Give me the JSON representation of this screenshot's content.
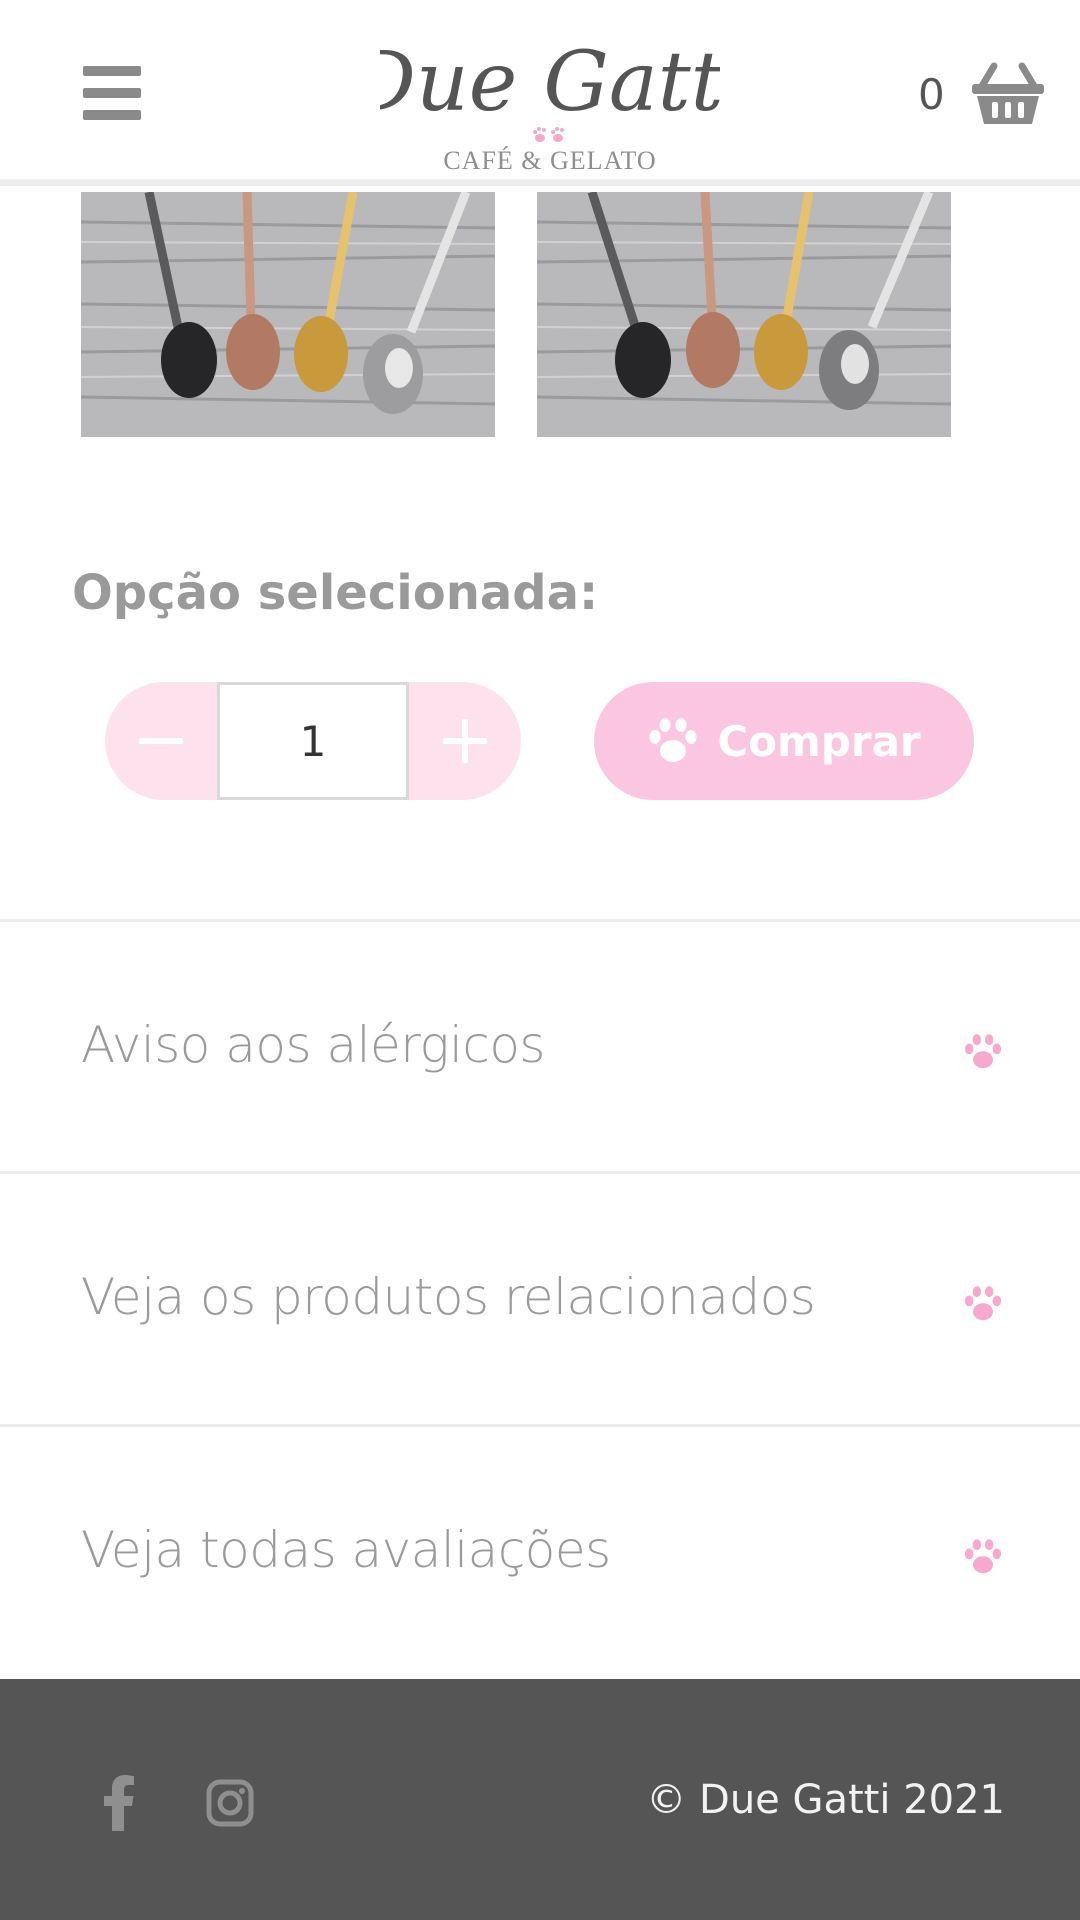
{
  "header": {
    "menu_icon": "hamburger-menu-icon",
    "logo_script": "Due Gatti",
    "logo_subtitle": "CAFÉ & GELATO",
    "cart_count": "0",
    "cart_icon": "basket-icon"
  },
  "product": {
    "images": [
      "spoons-photo",
      "spoons-photo"
    ],
    "option_label": "Opção selecionada:",
    "quantity": "1",
    "buy_label": "Comprar",
    "buy_icon": "paw-icon"
  },
  "accordion": [
    {
      "title": "Aviso aos alérgicos",
      "icon": "paw-icon"
    },
    {
      "title": "Veja os produtos relacionados",
      "icon": "paw-icon"
    },
    {
      "title": "Veja todas avaliações",
      "icon": "paw-icon"
    }
  ],
  "footer": {
    "facebook_icon": "facebook-icon",
    "instagram_icon": "instagram-icon",
    "copyright": "© Due Gatti 2021"
  },
  "colors": {
    "accent_pink": "#fbc7e0",
    "stepper_pink": "#fde2ee",
    "paw_pink": "#f7a8cc",
    "footer_bg": "#555555",
    "text_gray": "#9a9a9a"
  }
}
